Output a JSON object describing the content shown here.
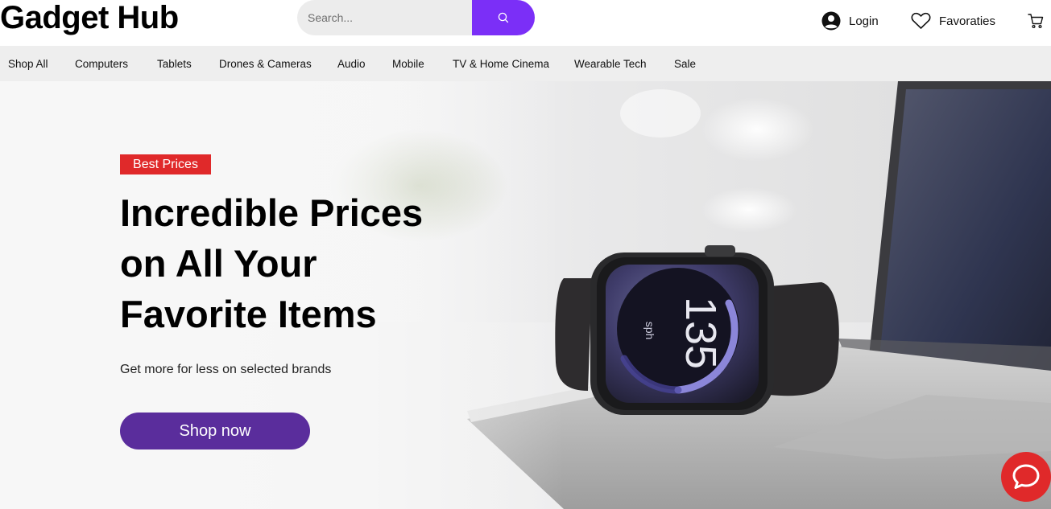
{
  "header": {
    "logo": "Gadget Hub",
    "search": {
      "placeholder": "Search...",
      "icon": "search-icon"
    },
    "login_label": "Login",
    "favorites_label": "Favoraties",
    "cart_icon": "cart-icon"
  },
  "nav": {
    "items": [
      "Shop All",
      "Computers",
      "Tablets",
      "Drones & Cameras",
      "Audio",
      "Mobile",
      "TV & Home Cinema",
      "Wearable Tech",
      "Sale"
    ]
  },
  "hero": {
    "badge": "Best Prices",
    "headline": [
      "Incredible Prices",
      "on All Your",
      "Favorite Items"
    ],
    "subtext": "Get more for less on selected brands",
    "cta": "Shop now",
    "watch_value": "135",
    "watch_unit": "sph"
  },
  "colors": {
    "accent": "#7b2ff7",
    "cta": "#5a2d9c",
    "badge": "#e0292a",
    "nav_bg": "#eeeeee"
  },
  "chat": {
    "icon": "chat-bubble-icon"
  }
}
